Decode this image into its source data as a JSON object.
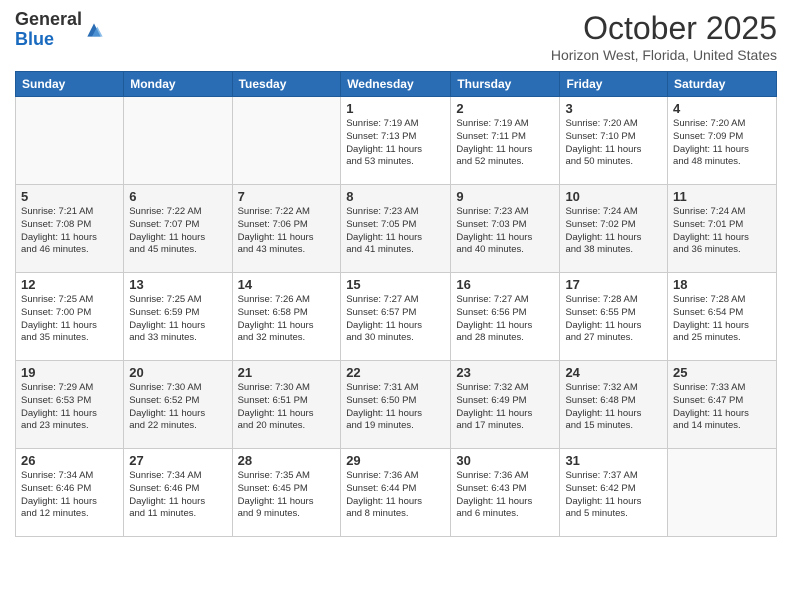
{
  "logo": {
    "general": "General",
    "blue": "Blue"
  },
  "header": {
    "month": "October 2025",
    "location": "Horizon West, Florida, United States"
  },
  "weekdays": [
    "Sunday",
    "Monday",
    "Tuesday",
    "Wednesday",
    "Thursday",
    "Friday",
    "Saturday"
  ],
  "weeks": [
    [
      {
        "day": "",
        "info": ""
      },
      {
        "day": "",
        "info": ""
      },
      {
        "day": "",
        "info": ""
      },
      {
        "day": "1",
        "info": "Sunrise: 7:19 AM\nSunset: 7:13 PM\nDaylight: 11 hours\nand 53 minutes."
      },
      {
        "day": "2",
        "info": "Sunrise: 7:19 AM\nSunset: 7:11 PM\nDaylight: 11 hours\nand 52 minutes."
      },
      {
        "day": "3",
        "info": "Sunrise: 7:20 AM\nSunset: 7:10 PM\nDaylight: 11 hours\nand 50 minutes."
      },
      {
        "day": "4",
        "info": "Sunrise: 7:20 AM\nSunset: 7:09 PM\nDaylight: 11 hours\nand 48 minutes."
      }
    ],
    [
      {
        "day": "5",
        "info": "Sunrise: 7:21 AM\nSunset: 7:08 PM\nDaylight: 11 hours\nand 46 minutes."
      },
      {
        "day": "6",
        "info": "Sunrise: 7:22 AM\nSunset: 7:07 PM\nDaylight: 11 hours\nand 45 minutes."
      },
      {
        "day": "7",
        "info": "Sunrise: 7:22 AM\nSunset: 7:06 PM\nDaylight: 11 hours\nand 43 minutes."
      },
      {
        "day": "8",
        "info": "Sunrise: 7:23 AM\nSunset: 7:05 PM\nDaylight: 11 hours\nand 41 minutes."
      },
      {
        "day": "9",
        "info": "Sunrise: 7:23 AM\nSunset: 7:03 PM\nDaylight: 11 hours\nand 40 minutes."
      },
      {
        "day": "10",
        "info": "Sunrise: 7:24 AM\nSunset: 7:02 PM\nDaylight: 11 hours\nand 38 minutes."
      },
      {
        "day": "11",
        "info": "Sunrise: 7:24 AM\nSunset: 7:01 PM\nDaylight: 11 hours\nand 36 minutes."
      }
    ],
    [
      {
        "day": "12",
        "info": "Sunrise: 7:25 AM\nSunset: 7:00 PM\nDaylight: 11 hours\nand 35 minutes."
      },
      {
        "day": "13",
        "info": "Sunrise: 7:25 AM\nSunset: 6:59 PM\nDaylight: 11 hours\nand 33 minutes."
      },
      {
        "day": "14",
        "info": "Sunrise: 7:26 AM\nSunset: 6:58 PM\nDaylight: 11 hours\nand 32 minutes."
      },
      {
        "day": "15",
        "info": "Sunrise: 7:27 AM\nSunset: 6:57 PM\nDaylight: 11 hours\nand 30 minutes."
      },
      {
        "day": "16",
        "info": "Sunrise: 7:27 AM\nSunset: 6:56 PM\nDaylight: 11 hours\nand 28 minutes."
      },
      {
        "day": "17",
        "info": "Sunrise: 7:28 AM\nSunset: 6:55 PM\nDaylight: 11 hours\nand 27 minutes."
      },
      {
        "day": "18",
        "info": "Sunrise: 7:28 AM\nSunset: 6:54 PM\nDaylight: 11 hours\nand 25 minutes."
      }
    ],
    [
      {
        "day": "19",
        "info": "Sunrise: 7:29 AM\nSunset: 6:53 PM\nDaylight: 11 hours\nand 23 minutes."
      },
      {
        "day": "20",
        "info": "Sunrise: 7:30 AM\nSunset: 6:52 PM\nDaylight: 11 hours\nand 22 minutes."
      },
      {
        "day": "21",
        "info": "Sunrise: 7:30 AM\nSunset: 6:51 PM\nDaylight: 11 hours\nand 20 minutes."
      },
      {
        "day": "22",
        "info": "Sunrise: 7:31 AM\nSunset: 6:50 PM\nDaylight: 11 hours\nand 19 minutes."
      },
      {
        "day": "23",
        "info": "Sunrise: 7:32 AM\nSunset: 6:49 PM\nDaylight: 11 hours\nand 17 minutes."
      },
      {
        "day": "24",
        "info": "Sunrise: 7:32 AM\nSunset: 6:48 PM\nDaylight: 11 hours\nand 15 minutes."
      },
      {
        "day": "25",
        "info": "Sunrise: 7:33 AM\nSunset: 6:47 PM\nDaylight: 11 hours\nand 14 minutes."
      }
    ],
    [
      {
        "day": "26",
        "info": "Sunrise: 7:34 AM\nSunset: 6:46 PM\nDaylight: 11 hours\nand 12 minutes."
      },
      {
        "day": "27",
        "info": "Sunrise: 7:34 AM\nSunset: 6:46 PM\nDaylight: 11 hours\nand 11 minutes."
      },
      {
        "day": "28",
        "info": "Sunrise: 7:35 AM\nSunset: 6:45 PM\nDaylight: 11 hours\nand 9 minutes."
      },
      {
        "day": "29",
        "info": "Sunrise: 7:36 AM\nSunset: 6:44 PM\nDaylight: 11 hours\nand 8 minutes."
      },
      {
        "day": "30",
        "info": "Sunrise: 7:36 AM\nSunset: 6:43 PM\nDaylight: 11 hours\nand 6 minutes."
      },
      {
        "day": "31",
        "info": "Sunrise: 7:37 AM\nSunset: 6:42 PM\nDaylight: 11 hours\nand 5 minutes."
      },
      {
        "day": "",
        "info": ""
      }
    ]
  ]
}
